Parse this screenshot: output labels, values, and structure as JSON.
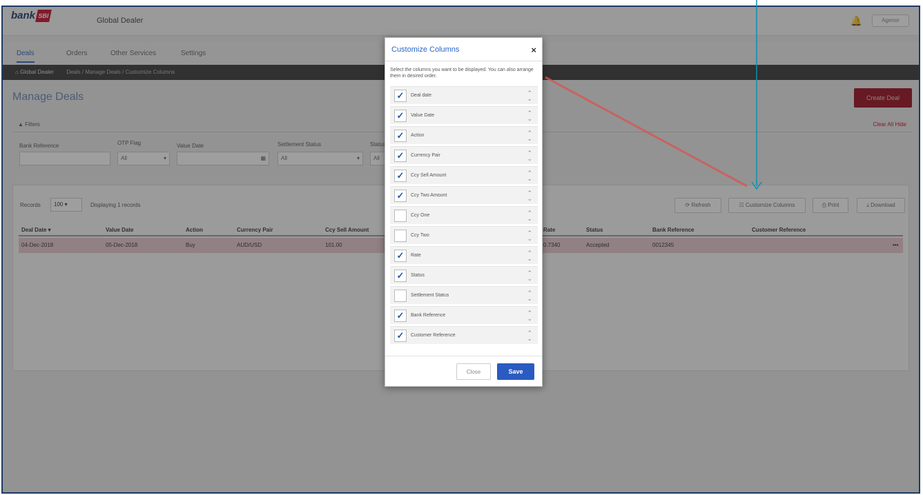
{
  "app": {
    "logo_text": "bank",
    "logo_mark": "SBI",
    "product_name": "Global Dealer",
    "user_label": "Agenor"
  },
  "nav": {
    "tabs": [
      {
        "label": "Deals"
      },
      {
        "label": "Orders"
      },
      {
        "label": "Other Services"
      },
      {
        "label": "Settings"
      }
    ]
  },
  "breadcrumb": {
    "root": "⌂ Global Dealer",
    "path": "Deals / Manage Deals / Customize Columns"
  },
  "page": {
    "title": "Manage Deals",
    "create_button": "Create Deal",
    "filters_label": "▲ Filters",
    "filter_links": "Clear All   Hide"
  },
  "filters": {
    "bank_reference_label": "Bank Reference",
    "otp_flag_label": "OTP Flag",
    "otp_flag_value": "All",
    "value_date_label": "Value Date",
    "settlement_status_label": "Settlement Status",
    "settlement_status_value": "All",
    "status_label": "Status",
    "status_value": "All"
  },
  "grid": {
    "records_label": "Records",
    "page_size": "100",
    "displaying": "Displaying 1 records",
    "toolbar": {
      "refresh": "Refresh",
      "customize": "Customize Columns",
      "print": "Print",
      "download": "Download"
    },
    "columns": [
      "Deal Date ▾",
      "Value Date",
      "Action",
      "Currency Pair",
      "Ccy Sell Amount",
      "Rate",
      "Status",
      "Bank Reference",
      "Customer Reference"
    ],
    "row": [
      "04-Dec-2018",
      "05-Dec-2018",
      "Buy",
      "AUD/USD",
      "101.00",
      "0.7340",
      "Accepted",
      "0012345",
      "",
      "•••"
    ]
  },
  "modal": {
    "title": "Customize Columns",
    "close_icon": "×",
    "description": "Select the columns you want to be displayed. You can also arrange them in desired order.",
    "items": [
      {
        "label": "Deal date",
        "checked": true
      },
      {
        "label": "Value Date",
        "checked": true
      },
      {
        "label": "Action",
        "checked": true
      },
      {
        "label": "Currency Pair",
        "checked": true
      },
      {
        "label": "Ccy Sell Amount",
        "checked": true
      },
      {
        "label": "Ccy Two Amount",
        "checked": true
      },
      {
        "label": "Ccy One",
        "checked": false
      },
      {
        "label": "Ccy Two",
        "checked": false
      },
      {
        "label": "Rate",
        "checked": true
      },
      {
        "label": "Status",
        "checked": true
      },
      {
        "label": "Settlement Status",
        "checked": false
      },
      {
        "label": "Bank Reference",
        "checked": true
      },
      {
        "label": "Customer Reference",
        "checked": true
      }
    ],
    "close_button": "Close",
    "save_button": "Save"
  },
  "colors": {
    "accent": "#2a5bc0",
    "brand": "#c8102e",
    "annotation_line": "#0a8fb5",
    "arrow_red": "#d9534f"
  }
}
